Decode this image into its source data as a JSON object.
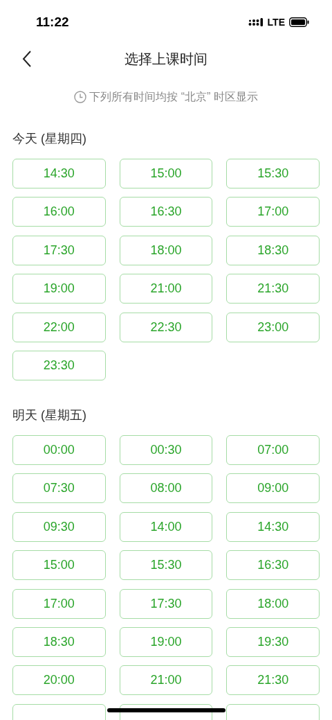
{
  "status_bar": {
    "time": "11:22",
    "network": "LTE"
  },
  "nav": {
    "title": "选择上课时间"
  },
  "notice": "下列所有时间均按 “北京” 时区显示",
  "sections": [
    {
      "heading": "今天 (星期四)",
      "slots": [
        "14:30",
        "15:00",
        "15:30",
        "16:00",
        "16:30",
        "17:00",
        "17:30",
        "18:00",
        "18:30",
        "19:00",
        "21:00",
        "21:30",
        "22:00",
        "22:30",
        "23:00",
        "23:30"
      ]
    },
    {
      "heading": "明天 (星期五)",
      "slots": [
        "00:00",
        "00:30",
        "07:00",
        "07:30",
        "08:00",
        "09:00",
        "09:30",
        "14:00",
        "14:30",
        "15:00",
        "15:30",
        "16:30",
        "17:00",
        "17:30",
        "18:00",
        "18:30",
        "19:00",
        "19:30",
        "20:00",
        "21:00",
        "21:30",
        {
          "kind": "partial"
        },
        {
          "kind": "partial"
        },
        {
          "kind": "partial"
        }
      ]
    }
  ]
}
